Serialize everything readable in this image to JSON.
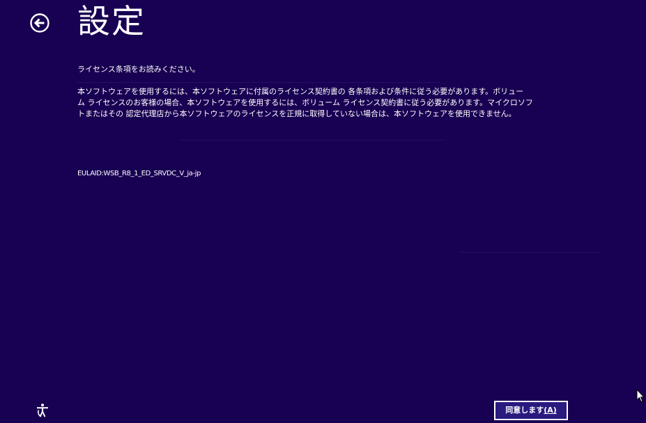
{
  "colors": {
    "background": "#180052",
    "text": "#ffffff",
    "button_fill": "#2a1a80",
    "button_border": "#ffffff"
  },
  "header": {
    "back_icon": "back-arrow-circle-icon",
    "title": "設定"
  },
  "license": {
    "subtitle": "ライセンス条項をお読みください。",
    "body_lines": [
      "本ソフトウェアを使用するには、本ソフトウェアに付属のライセンス契約書の 各条項および条件に従う必要があります。ボリュー",
      "ム ライセンスのお客様の場合、本ソフトウェアを使用するには、ボリューム ライセンス契約書に従う必要があります。マイクロソフ",
      "トまたはその 認定代理店から本ソフトウェアのライセンスを正規に取得していない場合は、本ソフトウェアを使用できません。"
    ],
    "eula_id": "EULAID:WSB_R8_1_ED_SRVDC_V_ja-jp"
  },
  "footer": {
    "ease_of_access_icon": "ease-of-access-icon",
    "accept_label": "同意します",
    "accept_mnemonic": "(A)"
  },
  "cursor": {
    "icon": "mouse-pointer-icon"
  }
}
